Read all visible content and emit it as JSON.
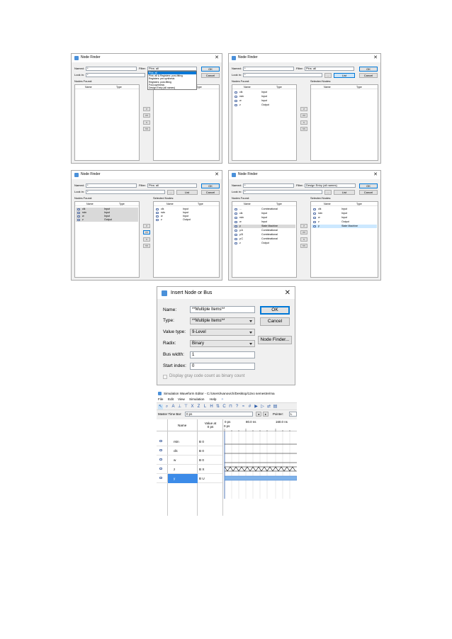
{
  "node_finder": {
    "title": "Node Finder",
    "close_glyph": "✕",
    "named_label": "Named:",
    "named_value": "*",
    "filter_label": "Filter:",
    "look_in_label": "Look in:",
    "look_in_value": "*",
    "browse_label": "...",
    "list_label": "List",
    "ok_label": "OK",
    "cancel_label": "Cancel",
    "nodes_found_label": "Nodes Found:",
    "selected_nodes_label": "Selected Nodes:",
    "col_name": "Name",
    "col_type": "Type",
    "arrows": [
      ">",
      ">>",
      "<",
      "<<"
    ],
    "filter_options": [
      "Pins: all",
      "Pins: all & Registers: post-fitting",
      "Registers: pre-synthesis",
      "Registers: post-fitting",
      "Post-synthesis",
      "Design Entry (all names)"
    ],
    "dialogs": [
      {
        "filter_value": "Pins: all",
        "found": [],
        "selected": []
      },
      {
        "filter_value": "Pins: all",
        "found": [
          {
            "name": "clk",
            "type": "Input"
          },
          {
            "name": "rstn",
            "type": "Input"
          },
          {
            "name": "w",
            "type": "Input"
          },
          {
            "name": "z",
            "type": "Output"
          }
        ],
        "selected": []
      },
      {
        "filter_value": "Pins: all",
        "found": [
          {
            "name": "clk",
            "type": "Input"
          },
          {
            "name": "rstn",
            "type": "Input"
          },
          {
            "name": "w",
            "type": "Input"
          },
          {
            "name": "z",
            "type": "Output"
          }
        ],
        "selected": [
          {
            "name": "clk",
            "type": "Input"
          },
          {
            "name": "rstn",
            "type": "Input"
          },
          {
            "name": "w",
            "type": "Input"
          },
          {
            "name": "z",
            "type": "Output"
          }
        ]
      },
      {
        "filter_value": "Design Entry (all names)",
        "found": [
          {
            "name": "...",
            "type": "Combinational"
          },
          {
            "name": "clk",
            "type": "Input"
          },
          {
            "name": "rstn",
            "type": "Input"
          },
          {
            "name": "w",
            "type": "Input"
          },
          {
            "name": "y",
            "type": "State Machine"
          },
          {
            "name": "y.A",
            "type": "Combinational"
          },
          {
            "name": "y.B",
            "type": "Combinational"
          },
          {
            "name": "y.C",
            "type": "Combinational"
          },
          {
            "name": "z",
            "type": "Output"
          }
        ],
        "selected": [
          {
            "name": "clk",
            "type": "Input"
          },
          {
            "name": "rstn",
            "type": "Input"
          },
          {
            "name": "w",
            "type": "Input"
          },
          {
            "name": "z",
            "type": "Output"
          },
          {
            "name": "y",
            "type": "State Machine"
          }
        ]
      }
    ]
  },
  "insert_node": {
    "title": "Insert Node or Bus",
    "close_glyph": "✕",
    "name_label": "Name:",
    "name_value": "**Multiple Items**",
    "type_label": "Type:",
    "type_value": "**Multiple Items**",
    "value_type_label": "Value type:",
    "value_type_value": "9-Level",
    "radix_label": "Radix:",
    "radix_value": "Binary",
    "bus_width_label": "Bus width:",
    "bus_width_value": "1",
    "start_index_label": "Start index:",
    "start_index_value": "0",
    "gray_code_label": "Display gray code count as binary count",
    "ok_label": "OK",
    "cancel_label": "Cancel",
    "node_finder_label": "Node Finder..."
  },
  "waveform": {
    "title": "Simulation Waveform Editor - C:/Users/Ivanovich/Desktop/12vo semestre/ma",
    "menu": [
      "File",
      "Edit",
      "View",
      "Simulation",
      "Help"
    ],
    "master_time_bar_label": "Master Time Bar:",
    "master_time_bar_value": "0 ps",
    "pointer_label": "Pointer:",
    "pointer_value": "L",
    "col_name": "Name",
    "col_value": "Value at\n0 ps",
    "time_labels": [
      "0 ps",
      "80.0 ns",
      "160.0 ns"
    ],
    "time_cursor": "0 ps",
    "signals": [
      {
        "name": "rstn",
        "value": "B 0"
      },
      {
        "name": "clk",
        "value": "B 0"
      },
      {
        "name": "w",
        "value": "B 0"
      },
      {
        "name": "z",
        "value": "B X"
      },
      {
        "name": "y",
        "value": "B U"
      }
    ]
  }
}
